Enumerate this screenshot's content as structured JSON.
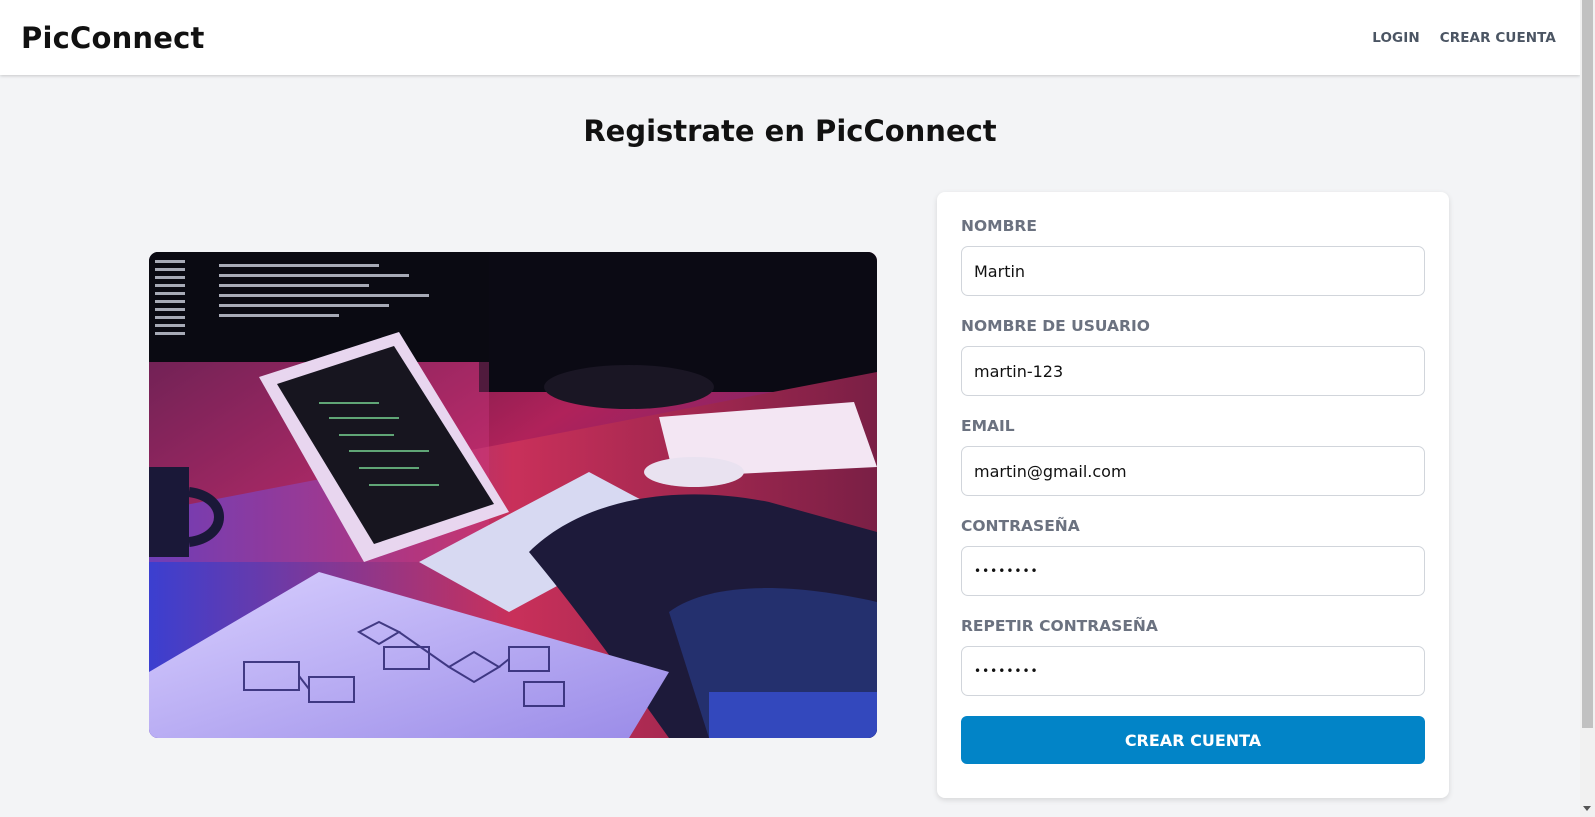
{
  "app": {
    "title": "PicConnect"
  },
  "nav": {
    "login": "Login",
    "signup": "Crear Cuenta"
  },
  "page": {
    "heading": "Registrate en PicConnect"
  },
  "image": {
    "description": ""
  },
  "form": {
    "name": {
      "label": "Nombre",
      "value": "Martin"
    },
    "username": {
      "label": "Nombre de Usuario",
      "value": "martin-123"
    },
    "email": {
      "label": "Email",
      "value": "martin@gmail.com"
    },
    "password": {
      "label": "Contraseña",
      "value": "password"
    },
    "repeat_password": {
      "label": "Repetir Contraseña",
      "value": "password"
    },
    "submit_label": "Crear Cuenta"
  },
  "colors": {
    "accent": "#0284c7",
    "background": "#f3f4f6"
  }
}
